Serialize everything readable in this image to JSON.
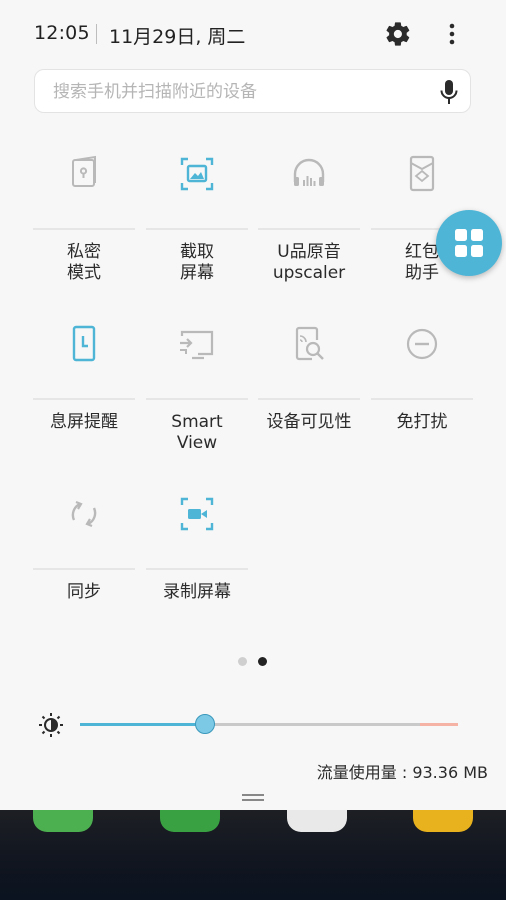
{
  "status": {
    "time": "12:05",
    "date": "11月29日, 周二"
  },
  "search": {
    "placeholder": "搜索手机并扫描附近的设备"
  },
  "tiles": [
    {
      "label": "私密\n模式",
      "icon": "private-mode-icon",
      "active": false
    },
    {
      "label": "截取\n屏幕",
      "icon": "screenshot-icon",
      "active": true
    },
    {
      "label": "U品原音\nupscaler",
      "icon": "headphones-icon",
      "active": false
    },
    {
      "label": "红包\n助手",
      "icon": "red-envelope-icon",
      "active": false
    },
    {
      "label": "息屏提醒",
      "icon": "always-on-display-icon",
      "active": true
    },
    {
      "label": "Smart\nView",
      "icon": "smart-view-icon",
      "active": false
    },
    {
      "label": "设备可见性",
      "icon": "device-visibility-icon",
      "active": false
    },
    {
      "label": "免打扰",
      "icon": "do-not-disturb-icon",
      "active": false
    },
    {
      "label": "同步",
      "icon": "sync-icon",
      "active": false
    },
    {
      "label": "录制屏幕",
      "icon": "screen-record-icon",
      "active": true
    }
  ],
  "pager": {
    "page_count": 2,
    "current": 2
  },
  "brightness": {
    "level": 0.33
  },
  "data_usage": "流量使用量 : 93.36 MB",
  "colors": {
    "accent": "#4eb5d6",
    "inactive_icon": "#b9b9b9",
    "background": "#f7f7f7"
  }
}
